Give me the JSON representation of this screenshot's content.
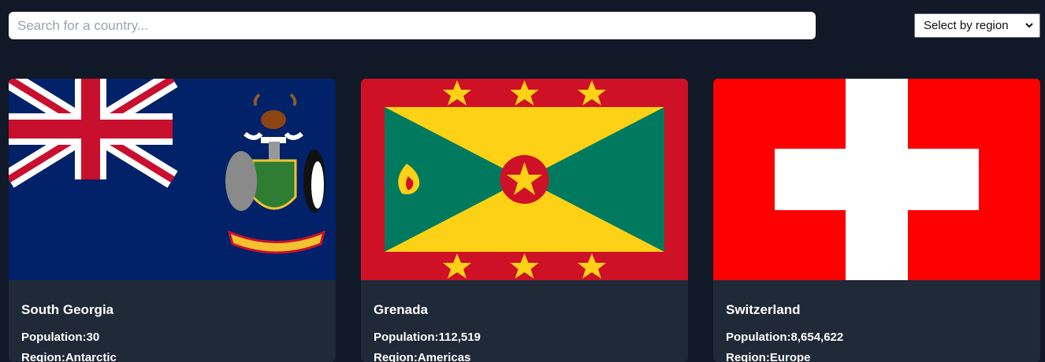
{
  "search": {
    "placeholder": "Search for a country..."
  },
  "region_filter": {
    "selected": "Select by region"
  },
  "countries": [
    {
      "name": "South Georgia",
      "population_label": "Population:",
      "population": "30",
      "region_label": "Region:",
      "region": "Antarctic",
      "flag_icon": "south-georgia-flag"
    },
    {
      "name": "Grenada",
      "population_label": "Population:",
      "population": "112,519",
      "region_label": "Region:",
      "region": "Americas",
      "flag_icon": "grenada-flag"
    },
    {
      "name": "Switzerland",
      "population_label": "Population:",
      "population": "8,654,622",
      "region_label": "Region:",
      "region": "Europe",
      "flag_icon": "switzerland-flag"
    }
  ],
  "colors": {
    "background": "#111827",
    "card": "#1f2937"
  }
}
